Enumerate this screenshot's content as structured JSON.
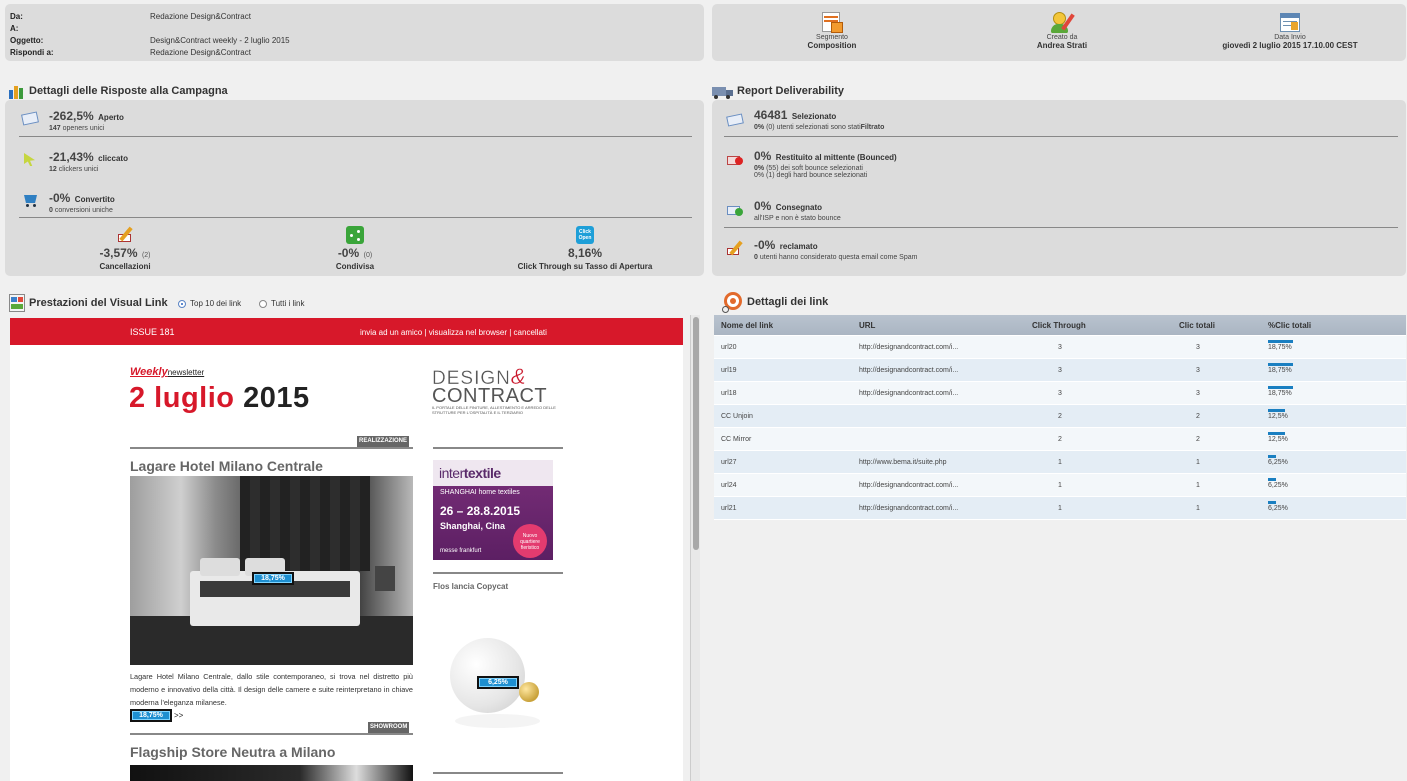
{
  "email_header": {
    "rows": [
      {
        "key": "Da:",
        "value": "Redazione Design&Contract"
      },
      {
        "key": "A:",
        "value": ""
      },
      {
        "key": "Oggetto:",
        "value": "Design&Contract weekly - 2 luglio 2015"
      },
      {
        "key": "Rispondi a:",
        "value": "Redazione Design&Contract"
      }
    ]
  },
  "info_boxes": [
    {
      "label": "Segmento",
      "value": "Composition",
      "icon": "segment-icon"
    },
    {
      "label": "Creato da",
      "value": "Andrea Strati",
      "icon": "creator-icon"
    },
    {
      "label": "Data Invio",
      "value": "giovedì 2 luglio 2015 17.10.00 CEST",
      "icon": "calendar-icon"
    }
  ],
  "responses": {
    "title": "Dettagli delle Risposte alla Campagna",
    "items": [
      {
        "big": "-262,5%",
        "label": "Aperto",
        "sub_bold": "147",
        "sub": "openers unici",
        "icon": "envelope-icon"
      },
      {
        "big": "-21,43%",
        "label": "cliccato",
        "sub_bold": "12",
        "sub": "clickers unici",
        "icon": "click-icon"
      },
      {
        "big": "-0%",
        "label": "Convertito",
        "sub_bold": "0",
        "sub": "conversioni uniche",
        "icon": "cart-icon"
      }
    ],
    "bottom": [
      {
        "big": "-3,57%",
        "small": "(2)",
        "label": "Cancellazioni",
        "icon": "unsubscribe-icon"
      },
      {
        "big": "-0%",
        "small": "(0)",
        "label": "Condivisa",
        "icon": "share-icon"
      },
      {
        "big": "8,16%",
        "small": "",
        "label": "Click Through su Tasso di Apertura",
        "icon": "click-open-icon",
        "icon_text": "Click Open"
      }
    ]
  },
  "deliverability": {
    "title": "Report Deliverability",
    "items": [
      {
        "big": "46481",
        "label": "Selezionato",
        "line1_bold": "0%",
        "line1": "(0) utenti selezionati sono stati",
        "line1_tail": "Filtrato",
        "line2": "",
        "icon": "selected-icon"
      },
      {
        "big": "0%",
        "label": "Restituito al mittente (Bounced)",
        "line1_bold": "0%",
        "line1": "(55) dei soft bounce selezionati",
        "line1_tail": "",
        "line2": "0% (1) degli hard bounce selezionati",
        "icon": "bounce-icon"
      },
      {
        "big": "0%",
        "label": "Consegnato",
        "line1_bold": "",
        "line1": "all'ISP e non è stato bounce",
        "line1_tail": "",
        "line2": "",
        "icon": "delivered-icon"
      },
      {
        "big": "-0%",
        "label": "reclamato",
        "line1_bold": "0",
        "line1": "utenti hanno considerato questa email come Spam",
        "line1_tail": "",
        "line2": "",
        "icon": "spam-icon"
      }
    ]
  },
  "visual_link": {
    "title": "Prestazioni del Visual Link",
    "options": [
      {
        "label": "Top 10 dei link",
        "selected": true
      },
      {
        "label": "Tutti i link",
        "selected": false
      }
    ]
  },
  "newsletter": {
    "issue": "ISSUE 181",
    "nav": "invia ad un amico | visualizza nel browser | cancellati",
    "weekly": "Weekly",
    "newsletter_word": "newsletter",
    "date_red": "2 luglio",
    "date_black": "2015",
    "brand_top": "DESIGN",
    "brand_amp": "&",
    "brand_bottom": "CONTRACT",
    "brand_tagline": "IL PORTALE DELLE FINITURE, ALLESTIMENTO E ARREDO DELLE STRUTTURE PER L'OSPITALITÀ E IL TERZIARIO",
    "section1": "REALIZZAZIONE",
    "article1_title": "Lagare Hotel Milano Centrale",
    "article1_text": "Lagare Hotel Milano Centrale, dallo stile contemporaneo, si trova nel distretto più moderno e innovativo della città. Il design delle camere e suite reinterpretano in chiave moderna l'eleganza milanese.",
    "more": ">>",
    "section2": "SHOWROOM",
    "article2_title": "Flagship Store Neutra a Milano",
    "ad_brand1": "inter",
    "ad_brand2": "textile",
    "ad_sub": "SHANGHAI home textiles",
    "ad_dates": "26 – 28.8.2015",
    "ad_city": "Shanghai, Cina",
    "ad_badge": "Nuovo quartiere fieristico",
    "ad_footer": "messe frankfurt",
    "side_title": "Flos lancia Copycat",
    "badges": [
      "18,75%",
      "6,25%",
      "18,75%"
    ]
  },
  "link_details": {
    "title": "Dettagli dei link",
    "headers": [
      "Nome del link",
      "URL",
      "Click Through",
      "Clic totali",
      "%Clic totali"
    ],
    "rows": [
      {
        "name": "url20",
        "url": "http://designandcontract.com/i...",
        "ct": "3",
        "tot": "3",
        "pct": "18,75%",
        "frac": 0.1875
      },
      {
        "name": "url19",
        "url": "http://designandcontract.com/i...",
        "ct": "3",
        "tot": "3",
        "pct": "18,75%",
        "frac": 0.1875
      },
      {
        "name": "url18",
        "url": "http://designandcontract.com/i...",
        "ct": "3",
        "tot": "3",
        "pct": "18,75%",
        "frac": 0.1875
      },
      {
        "name": "CC Unjoin",
        "url": "",
        "ct": "2",
        "tot": "2",
        "pct": "12,5%",
        "frac": 0.125
      },
      {
        "name": "CC Mirror",
        "url": "",
        "ct": "2",
        "tot": "2",
        "pct": "12,5%",
        "frac": 0.125
      },
      {
        "name": "url27",
        "url": "http://www.bema.it/suite.php",
        "ct": "1",
        "tot": "1",
        "pct": "6,25%",
        "frac": 0.0625
      },
      {
        "name": "url24",
        "url": "http://designandcontract.com/i...",
        "ct": "1",
        "tot": "1",
        "pct": "6,25%",
        "frac": 0.0625
      },
      {
        "name": "url21",
        "url": "http://designandcontract.com/i...",
        "ct": "1",
        "tot": "1",
        "pct": "6,25%",
        "frac": 0.0625
      }
    ]
  },
  "colors": {
    "accent_red": "#d7182a",
    "bar_blue": "#1a7fc1",
    "panel": "#dcdcdc"
  }
}
